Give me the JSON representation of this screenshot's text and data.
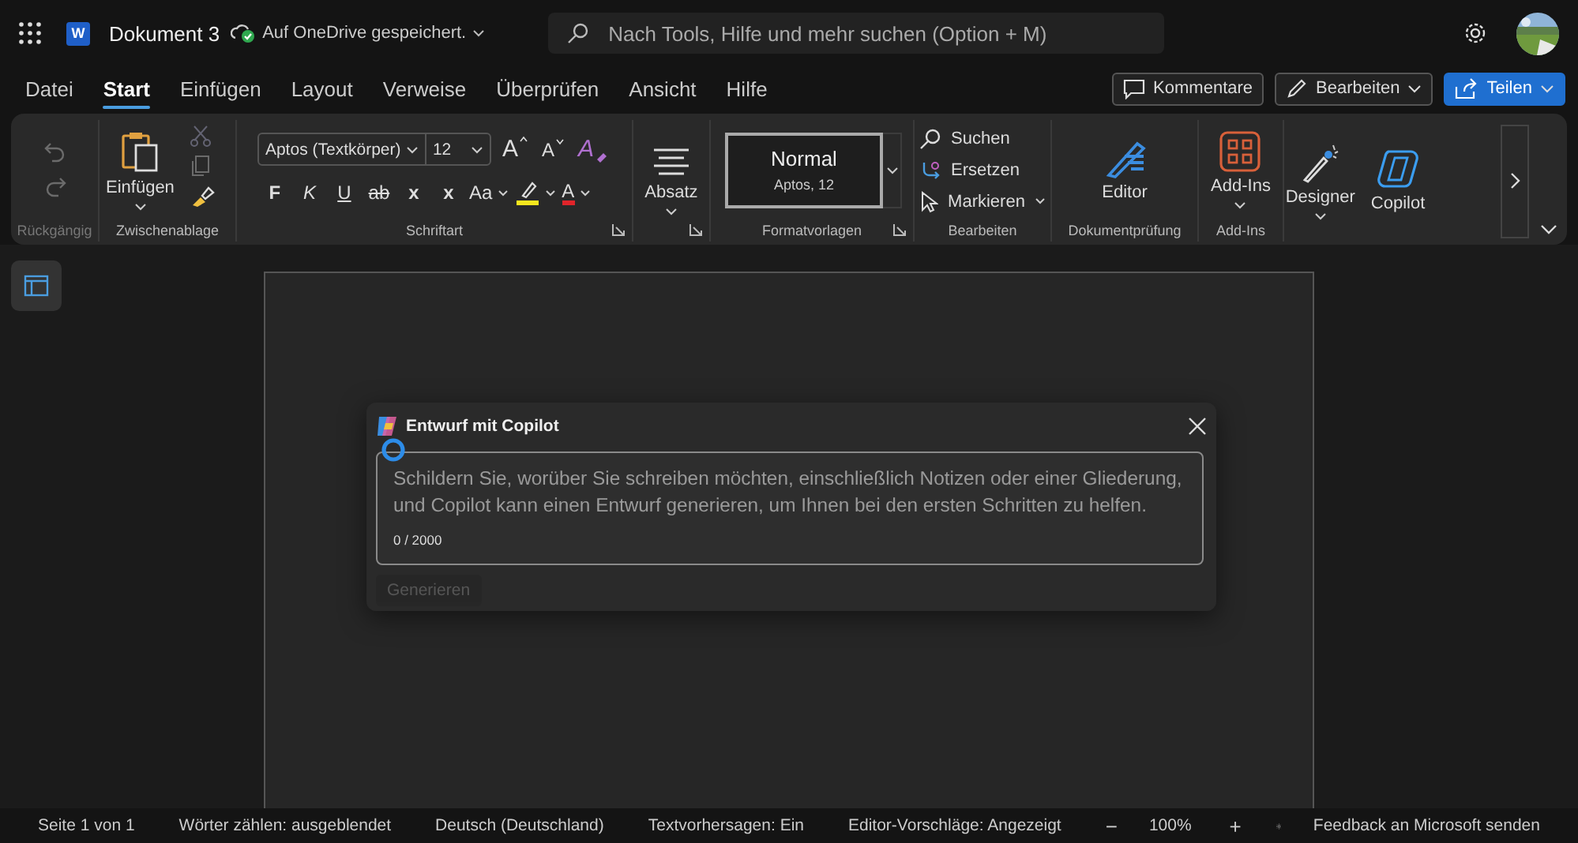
{
  "title_bar": {
    "logo_letter": "W",
    "document_title": "Dokument 3",
    "save_status": "Auf OneDrive gespeichert.",
    "search": {
      "placeholder": "Nach Tools, Hilfe und mehr suchen (Option + M)"
    }
  },
  "menu_tabs": [
    {
      "label": "Datei",
      "selected": false
    },
    {
      "label": "Start",
      "selected": true
    },
    {
      "label": "Einfügen",
      "selected": false
    },
    {
      "label": "Layout",
      "selected": false
    },
    {
      "label": "Verweise",
      "selected": false
    },
    {
      "label": "Überprüfen",
      "selected": false
    },
    {
      "label": "Ansicht",
      "selected": false
    },
    {
      "label": "Hilfe",
      "selected": false
    }
  ],
  "actions": [
    {
      "label": "Kommentare",
      "kind": "comment",
      "dropdown": false
    },
    {
      "label": "Bearbeiten",
      "kind": "edit",
      "dropdown": true
    },
    {
      "label": "Teilen",
      "kind": "share",
      "dropdown": true
    }
  ],
  "ribbon": {
    "undo": {
      "label": "Rückgängig",
      "disabled": true
    },
    "clipboard": {
      "label": "Zwischenablage",
      "paste": "Einfügen"
    },
    "font": {
      "label": "Schriftart",
      "font_name": "Aptos (Textkörper)",
      "font_size": "12",
      "grow": "A",
      "shrink": "A",
      "clear": "A",
      "formats": [
        {
          "text": "F",
          "kind": "bold"
        },
        {
          "text": "K",
          "kind": "italic"
        },
        {
          "text": "U",
          "kind": "underline"
        },
        {
          "text": "ab",
          "kind": "strike"
        },
        {
          "text": "x",
          "kind": "sub"
        },
        {
          "text": "x",
          "kind": "sup"
        },
        {
          "text": "Aa",
          "kind": "case"
        },
        {
          "kind": "highlight",
          "color": "#f5e61e"
        },
        {
          "text": "A",
          "kind": "fontcolor",
          "color": "#e0242a"
        }
      ]
    },
    "paragraph": {
      "label": "Absatz"
    },
    "styles": {
      "label": "Formatvorlagen",
      "items": [
        {
          "name": "Normal",
          "detail": "Aptos, 12",
          "selected": true
        }
      ]
    },
    "editing": {
      "label": "Bearbeiten",
      "items": [
        {
          "label": "Suchen",
          "kind": "find",
          "dropdown": false
        },
        {
          "label": "Ersetzen",
          "kind": "replace",
          "dropdown": false
        },
        {
          "label": "Markieren",
          "kind": "select",
          "dropdown": true
        }
      ]
    },
    "proofing": {
      "label": "Dokumentprüfung",
      "button": "Editor"
    },
    "addins": {
      "label": "Add-Ins",
      "button": "Add-Ins"
    },
    "ai": {
      "buttons": [
        {
          "label": "Designer",
          "kind": "designer",
          "dropdown": true
        },
        {
          "label": "Copilot",
          "kind": "copilot",
          "dropdown": false
        }
      ]
    }
  },
  "copilot_dialog": {
    "title": "Entwurf mit Copilot",
    "prompt": {
      "placeholder": "Schildern Sie, worüber Sie schreiben möchten, einschließlich Notizen oder einer Gliederung, und Copilot kann einen Entwurf generieren, um Ihnen bei den ersten Schritten zu helfen."
    },
    "counter": "0 / 2000",
    "generate": {
      "label": "Generieren",
      "disabled": true
    }
  },
  "status_bar": {
    "items": [
      "Seite 1 von 1",
      "Wörter zählen: ausgeblendet",
      "Deutsch (Deutschland)",
      "Textvorhersagen: Ein",
      "Editor-Vorschläge: Angezeigt"
    ],
    "zoom_out": "−",
    "zoom": "100%",
    "zoom_in": "+",
    "feedback": "Feedback an Microsoft senden"
  }
}
